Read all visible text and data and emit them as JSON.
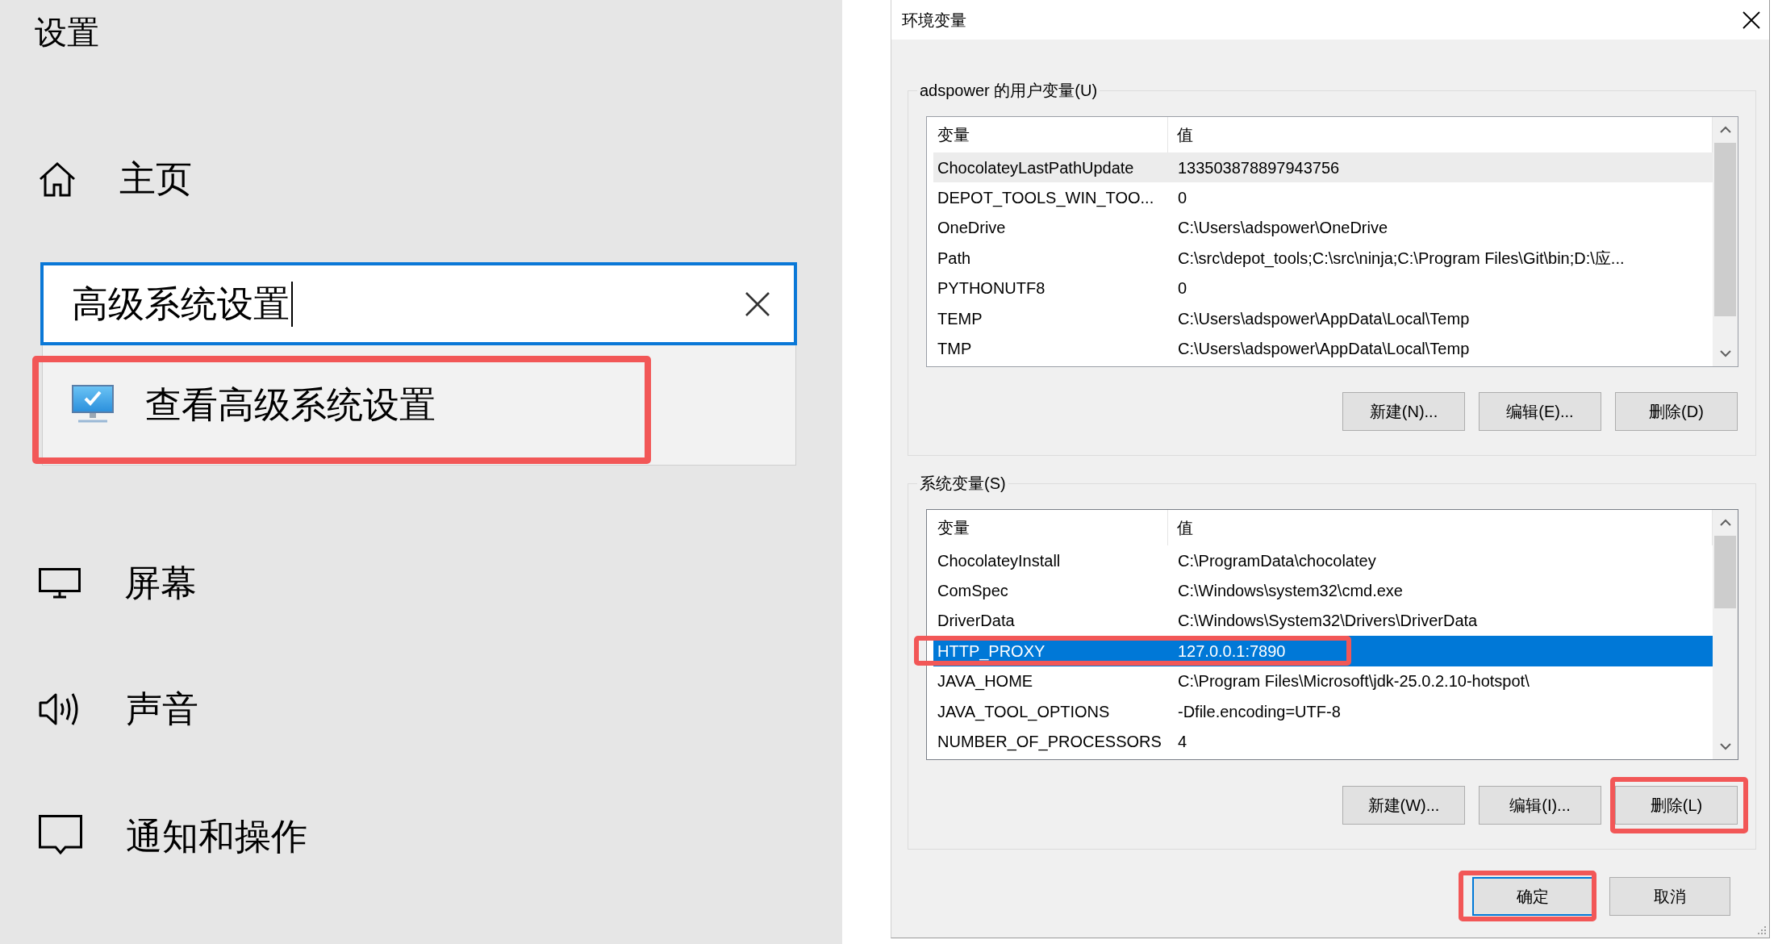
{
  "settings": {
    "title": "设置",
    "home": {
      "label": "主页"
    },
    "search": {
      "value": "高级系统设置",
      "focused": true
    },
    "suggestions": [
      {
        "label": "查看高级系统设置",
        "annotated": true
      }
    ],
    "nav": [
      {
        "label": "屏幕"
      },
      {
        "label": "声音"
      },
      {
        "label": "通知和操作"
      }
    ]
  },
  "dialog": {
    "title": "环境变量",
    "groups": [
      {
        "label": "adspower 的用户变量(U)",
        "focused": false,
        "table": {
          "columns": [
            "变量",
            "值"
          ],
          "rows": [
            {
              "cells": [
                "ChocolateyLastPathUpdate",
                "133503878897943756"
              ],
              "selected": true,
              "annotated": false
            },
            {
              "cells": [
                "DEPOT_TOOLS_WIN_TOO...",
                "0"
              ],
              "selected": false,
              "annotated": false
            },
            {
              "cells": [
                "OneDrive",
                "C:\\Users\\adspower\\OneDrive"
              ],
              "selected": false,
              "annotated": false
            },
            {
              "cells": [
                "Path",
                "C:\\src\\depot_tools;C:\\src\\ninja;C:\\Program Files\\Git\\bin;D:\\应..."
              ],
              "selected": false,
              "annotated": false
            },
            {
              "cells": [
                "PYTHONUTF8",
                "0"
              ],
              "selected": false,
              "annotated": false
            },
            {
              "cells": [
                "TEMP",
                "C:\\Users\\adspower\\AppData\\Local\\Temp"
              ],
              "selected": false,
              "annotated": false
            },
            {
              "cells": [
                "TMP",
                "C:\\Users\\adspower\\AppData\\Local\\Temp"
              ],
              "selected": false,
              "annotated": false
            }
          ]
        },
        "buttons": [
          {
            "label": "新建(N)...",
            "annotated": false
          },
          {
            "label": "编辑(E)...",
            "annotated": false
          },
          {
            "label": "删除(D)",
            "annotated": false
          }
        ]
      },
      {
        "label": "系统变量(S)",
        "focused": true,
        "table": {
          "columns": [
            "变量",
            "值"
          ],
          "rows": [
            {
              "cells": [
                "ChocolateyInstall",
                "C:\\ProgramData\\chocolatey"
              ],
              "selected": false,
              "annotated": false
            },
            {
              "cells": [
                "ComSpec",
                "C:\\Windows\\system32\\cmd.exe"
              ],
              "selected": false,
              "annotated": false
            },
            {
              "cells": [
                "DriverData",
                "C:\\Windows\\System32\\Drivers\\DriverData"
              ],
              "selected": false,
              "annotated": false
            },
            {
              "cells": [
                "HTTP_PROXY",
                "127.0.0.1:7890"
              ],
              "selected": true,
              "annotated": true
            },
            {
              "cells": [
                "JAVA_HOME",
                "C:\\Program Files\\Microsoft\\jdk-25.0.2.10-hotspot\\"
              ],
              "selected": false,
              "annotated": false
            },
            {
              "cells": [
                "JAVA_TOOL_OPTIONS",
                "-Dfile.encoding=UTF-8"
              ],
              "selected": false,
              "annotated": false
            },
            {
              "cells": [
                "NUMBER_OF_PROCESSORS",
                "4"
              ],
              "selected": false,
              "annotated": false
            }
          ]
        },
        "buttons": [
          {
            "label": "新建(W)...",
            "annotated": false
          },
          {
            "label": "编辑(I)...",
            "annotated": false
          },
          {
            "label": "删除(L)",
            "annotated": true
          }
        ]
      }
    ],
    "buttons": [
      {
        "label": "确定",
        "default": true,
        "annotated": true
      },
      {
        "label": "取消",
        "default": false,
        "annotated": false
      }
    ]
  }
}
